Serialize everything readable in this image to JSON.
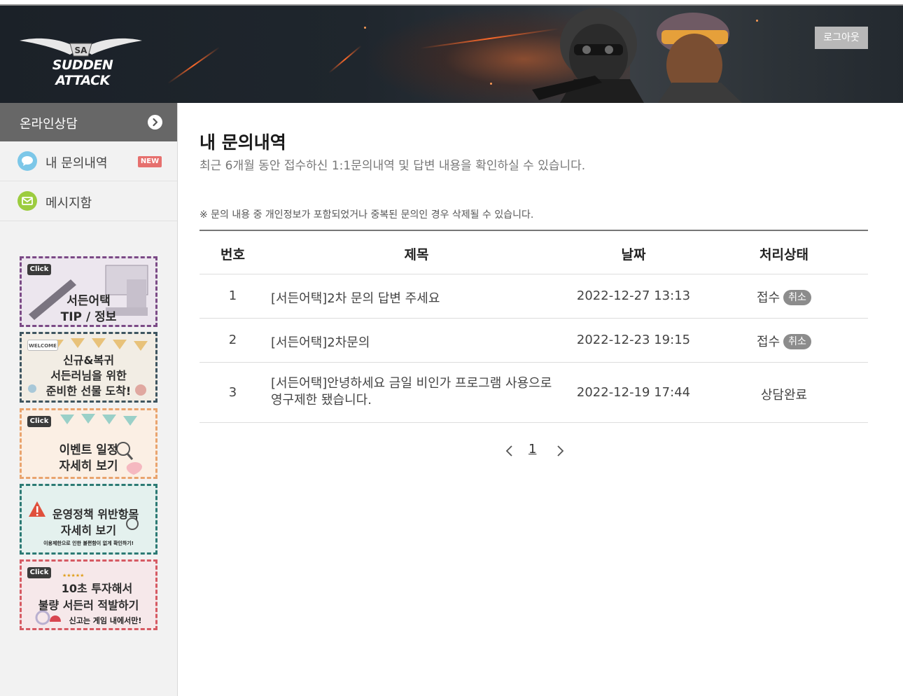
{
  "header": {
    "logo_text": "SUDDEN ATTACK",
    "logo_emblem": "SA",
    "logout_label": "로그아웃"
  },
  "sidebar": {
    "title": "온라인상담",
    "items": [
      {
        "label": "내 문의내역",
        "badge": "NEW",
        "icon": "chat-bubble-icon",
        "icon_color": "#7cc7e8"
      },
      {
        "label": "메시지함",
        "icon": "envelope-icon",
        "icon_color": "#9ccc3f"
      }
    ],
    "banners": [
      {
        "tag": "Click",
        "lines": [
          "서든어택",
          "TIP / 정보"
        ],
        "border": "#7b4a86",
        "bg": "#ece6ee"
      },
      {
        "tag": "WELCOME",
        "lines": [
          "신규&복귀",
          "서든러님을 위한",
          "준비한 선물 도착!"
        ],
        "border": "#3e5560",
        "bg": "#f2ede4"
      },
      {
        "tag": "Click",
        "lines": [
          "이벤트 일정",
          "자세히 보기"
        ],
        "border": "#e9a46e",
        "bg": "#fbefe4"
      },
      {
        "tag": "",
        "lines": [
          "운영정책 위반항목",
          "자세히 보기"
        ],
        "small": "이용제한으로 인한 불편함이 없게 확인하기!",
        "border": "#2c7a74",
        "bg": "#e4f1ee"
      },
      {
        "tag": "Click",
        "lines": [
          "10초 투자해서",
          "불량 서든러 적발하기"
        ],
        "small": "신고는 게임 내에서만!",
        "border": "#d65a63",
        "bg": "#f6e8ea"
      }
    ]
  },
  "main": {
    "title": "내 문의내역",
    "subtitle": "최근 6개월 동안 접수하신 1:1문의내역 및 답변 내용을 확인하실 수 있습니다.",
    "notice": "※ 문의 내용 중 개인정보가 포함되었거나 중복된 문의인 경우 삭제될 수 있습니다.",
    "columns": [
      "번호",
      "제목",
      "날짜",
      "처리상태"
    ],
    "rows": [
      {
        "no": "1",
        "title": "[서든어택]2차 문의 답변 주세요",
        "date": "2022-12-27 13:13",
        "status": "접수",
        "action": "취소"
      },
      {
        "no": "2",
        "title": "[서든어택]2차문의",
        "date": "2022-12-23 19:15",
        "status": "접수",
        "action": "취소"
      },
      {
        "no": "3",
        "title": "[서든어택]안녕하세요 금일 비인가 프로그램 사용으로 영구제한 됐습니다.",
        "date": "2022-12-19 17:44",
        "status": "상담완료",
        "action": ""
      }
    ],
    "pagination": {
      "current": "1"
    }
  }
}
